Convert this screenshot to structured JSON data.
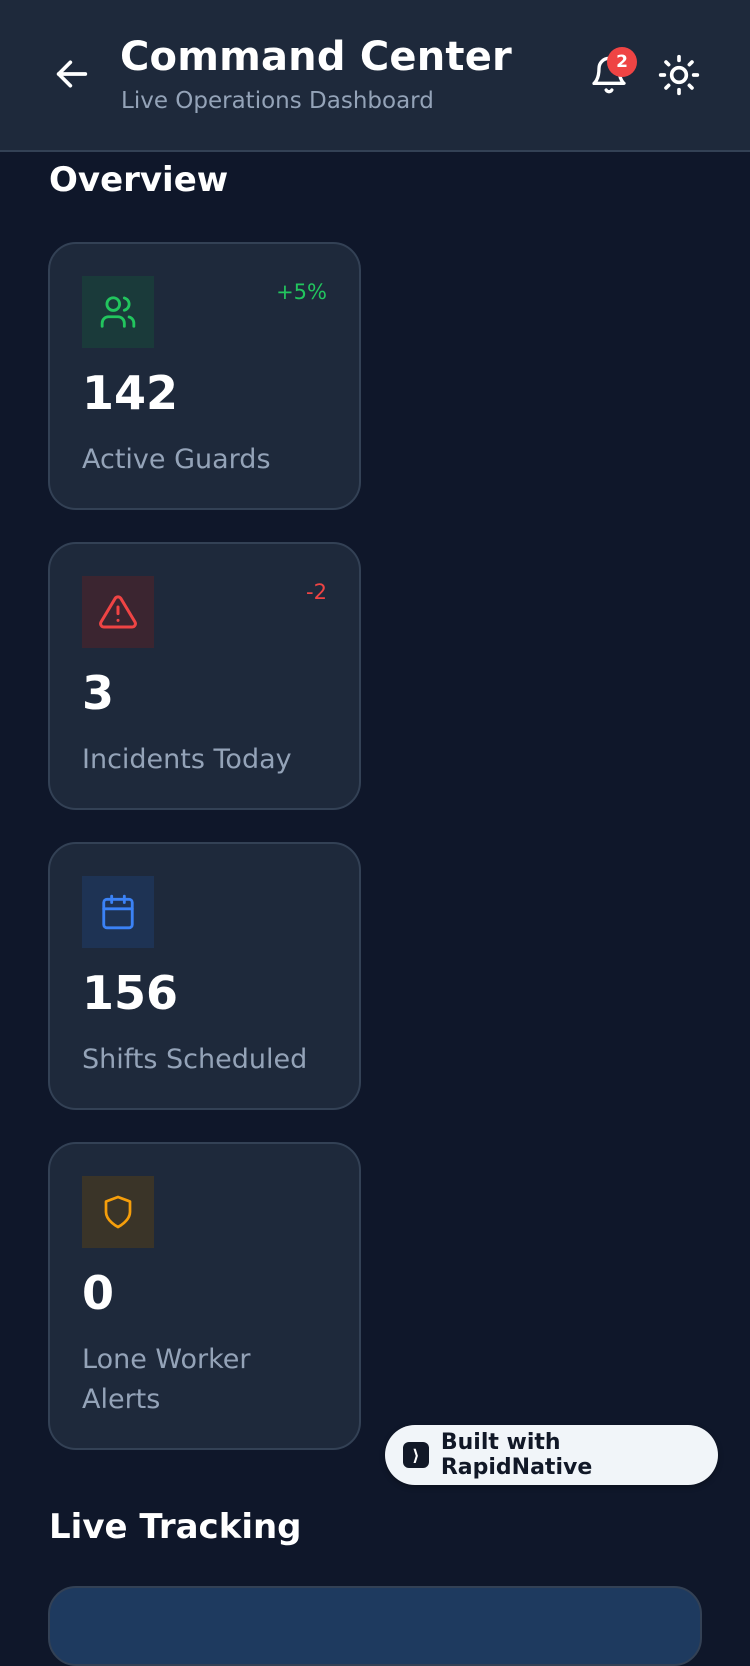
{
  "header": {
    "title": "Command Center",
    "subtitle": "Live Operations Dashboard",
    "notification_count": "2"
  },
  "overview": {
    "title": "Overview",
    "cards": [
      {
        "value": "142",
        "label": "Active Guards",
        "change": "+5%",
        "icon": "users-icon",
        "color": "#22c55e"
      },
      {
        "value": "3",
        "label": "Incidents Today",
        "change": "-2",
        "icon": "alert-triangle-icon",
        "color": "#ef4444"
      },
      {
        "value": "156",
        "label": "Shifts Scheduled",
        "change": "",
        "icon": "calendar-icon",
        "color": "#3b82f6"
      },
      {
        "value": "0",
        "label": "Lone Worker Alerts",
        "change": "",
        "icon": "shield-icon",
        "color": "#f59e0b"
      }
    ]
  },
  "live_tracking": {
    "title": "Live Tracking"
  },
  "built_with": {
    "label": "Built with RapidNative"
  },
  "colors": {
    "background": "#0f172a",
    "surface": "#1e293b",
    "border": "#334155",
    "muted_text": "#94a3b8",
    "success": "#22c55e",
    "danger": "#ef4444",
    "info": "#3b82f6",
    "warning": "#f59e0b"
  }
}
